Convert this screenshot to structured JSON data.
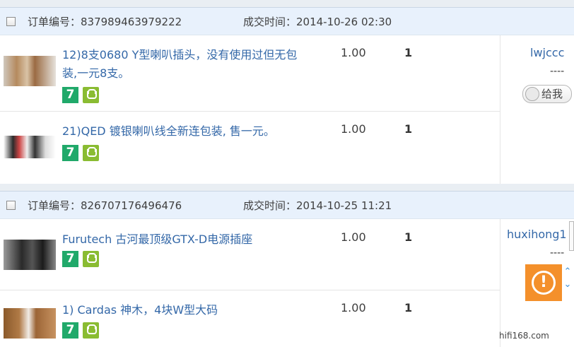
{
  "orders": [
    {
      "order_no": "订单编号：837989463979222",
      "deal_time": "成交时间：2014-10-26 02:30",
      "seller": "lwjccc",
      "seller_dash": "----",
      "chat_label": "给我",
      "items": [
        {
          "title": "12)8支0680 Y型喇叭插头，没有使用过但无包装,一元8支。",
          "price": "1.00",
          "qty": "1",
          "badge_num": "7"
        },
        {
          "title": "21)QED 镀银喇叭线全新连包装, 售一元。",
          "price": "1.00",
          "qty": "1",
          "badge_num": "7"
        }
      ]
    },
    {
      "order_no": "订单编号：826707176496476",
      "deal_time": "成交时间：2014-10-25 11:21",
      "seller": "huxihong1",
      "seller_dash": "----",
      "items": [
        {
          "title": "Furutech 古河最顶级GTX-D电源插座",
          "price": "1.00",
          "qty": "1",
          "badge_num": "7"
        },
        {
          "title": "1) Cardas 神木，4块W型大码",
          "price": "1.00",
          "qty": "1",
          "badge_num": "7"
        }
      ]
    }
  ],
  "float_widget": {
    "mark": "!",
    "up": "⌃",
    "down": "⌄"
  },
  "watermark": "hifi168.com",
  "colors": {
    "header_bg": "#e8f1fc",
    "link": "#3468a8",
    "badge_green": "#20a96a",
    "badge_lime": "#8abc32",
    "widget_orange": "#f4902b"
  }
}
